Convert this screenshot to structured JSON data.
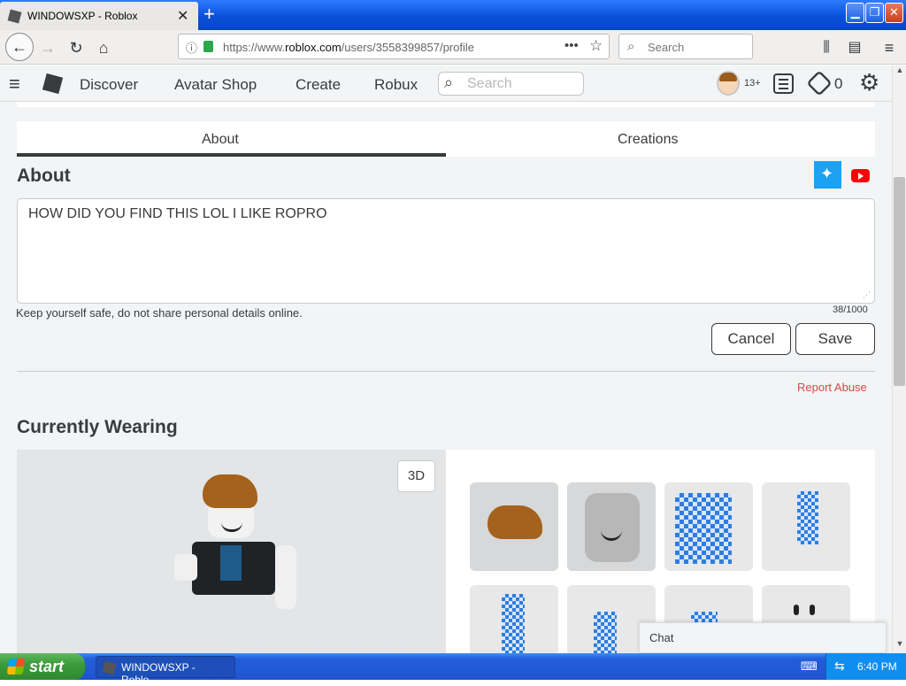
{
  "browser": {
    "tab_title": "WINDOWSXP - Roblox",
    "url_prefix": "https://www.",
    "url_domain": "roblox.com",
    "url_path": "/users/3558399857/profile",
    "search_placeholder": "Search"
  },
  "roblox_header": {
    "nav": [
      "Discover",
      "Avatar Shop",
      "Create",
      "Robux"
    ],
    "search_placeholder": "Search",
    "age_badge": "13+",
    "robux_count": "0"
  },
  "profile": {
    "tabs": [
      "About",
      "Creations"
    ],
    "active_tab": "About",
    "about_heading": "About",
    "bio_text": "HOW DID YOU FIND THIS LOL I LIKE ROPRO",
    "safety_note": "Keep yourself safe, do not share personal details online.",
    "char_count": "38/1000",
    "cancel_label": "Cancel",
    "save_label": "Save",
    "report_label": "Report Abuse",
    "wearing_heading": "Currently Wearing",
    "view_3d_label": "3D"
  },
  "chat": {
    "label": "Chat"
  },
  "taskbar": {
    "start_label": "start",
    "task_label": "WINDOWSXP - Roblo...",
    "clock": "6:40 PM"
  },
  "colors": {
    "twitter": "#1da1f2",
    "youtube": "#ff0000",
    "report": "#d24b45",
    "xp_blue": "#245edb"
  }
}
